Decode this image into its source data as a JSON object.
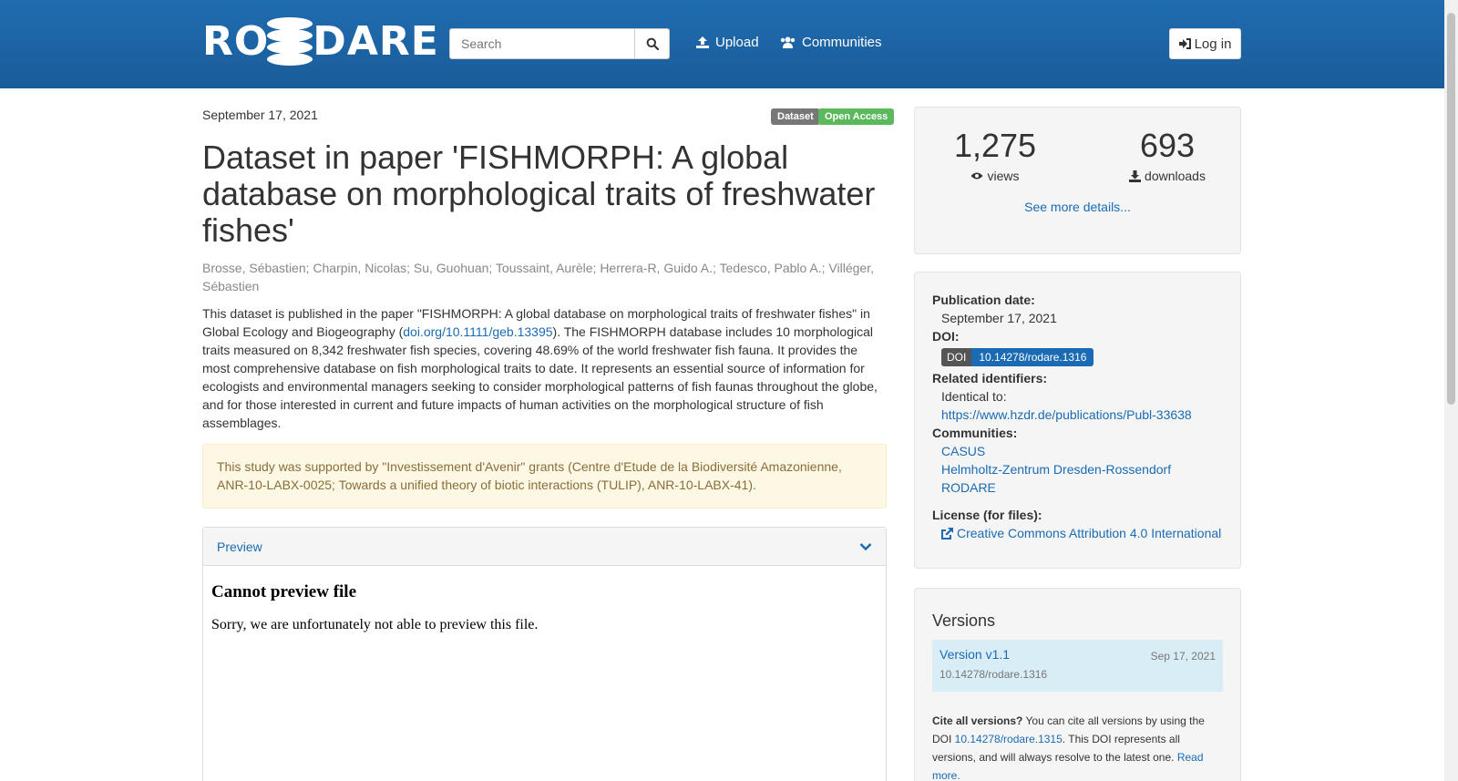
{
  "header": {
    "logo_left": "RO",
    "logo_right": "DARE",
    "search_placeholder": "Search",
    "upload_label": "Upload",
    "communities_label": "Communities",
    "login_label": "Log in"
  },
  "record": {
    "date": "September 17, 2021",
    "badges": [
      "Dataset",
      "Open Access"
    ],
    "badge_colors": [
      "#777777",
      "#5cb85c"
    ],
    "title": "Dataset in paper 'FISHMORPH: A global database on morphological traits of freshwater fishes'",
    "authors": "Brosse, Sébastien; Charpin, Nicolas; Su, Guohuan; Toussaint, Aurèle; Herrera-R, Guido A.; Tedesco, Pablo A.; Villéger, Sébastien",
    "desc_before": "This dataset is published in the paper \"FISHMORPH: A global database on morphological traits of freshwater fishes\" in Global Ecology and Biogeography (",
    "desc_link": "doi.org/10.1111/geb.13395",
    "desc_after": "). The FISHMORPH database includes 10 morphological traits measured on 8,342 freshwater fish species, covering 48.69% of the world freshwater fish fauna. It provides the most comprehensive database on fish morphological traits to date. It represents an essential source of information for ecologists and environmental managers seeking to consider morphological patterns of fish faunas throughout the globe, and for those interested in current and future impacts of human activities on the morphological structure of fish assemblages.",
    "notice": "This study was supported by \"Investissement d'Avenir\" grants (Centre d'Etude de la Biodiversité Amazonienne, ANR-10-LABX-0025; Towards a unified theory of biotic interactions (TULIP), ANR-10-LABX-41).",
    "preview_label": "Preview",
    "preview_title": "Cannot preview file",
    "preview_message": "Sorry, we are unfortunately not able to preview this file."
  },
  "stats": {
    "views": "1,275",
    "views_label": "views",
    "downloads": "693",
    "downloads_label": "downloads",
    "see_more": "See more details..."
  },
  "meta": {
    "pub_date_label": "Publication date:",
    "pub_date": "September 17, 2021",
    "doi_label": "DOI:",
    "doi_prefix": "DOI",
    "doi": "10.14278/rodare.1316",
    "related_label": "Related identifiers:",
    "identical_to": "Identical to:",
    "related_link": "https://www.hzdr.de/publications/Publ-33638",
    "communities_label": "Communities:",
    "communities": [
      "CASUS",
      "Helmholtz-Zentrum Dresden-Rossendorf",
      "RODARE"
    ],
    "license_label": "License (for files):",
    "license": "Creative Commons Attribution 4.0 International"
  },
  "versions": {
    "heading": "Versions",
    "version_name": "Version v1.1",
    "version_date": "Sep 17, 2021",
    "version_doi": "10.14278/rodare.1316",
    "cite_bold": "Cite all versions?",
    "cite_text1": " You can cite all versions by using the DOI ",
    "cite_doi": "10.14278/rodare.1315",
    "cite_text2": ". This DOI represents all versions, and will always resolve to the latest one. ",
    "read_more": "Read more."
  },
  "icons": [
    "search-icon",
    "upload-icon",
    "users-icon",
    "sign-in-icon",
    "eye-icon",
    "download-icon",
    "chevron-down-icon",
    "external-link-icon"
  ]
}
